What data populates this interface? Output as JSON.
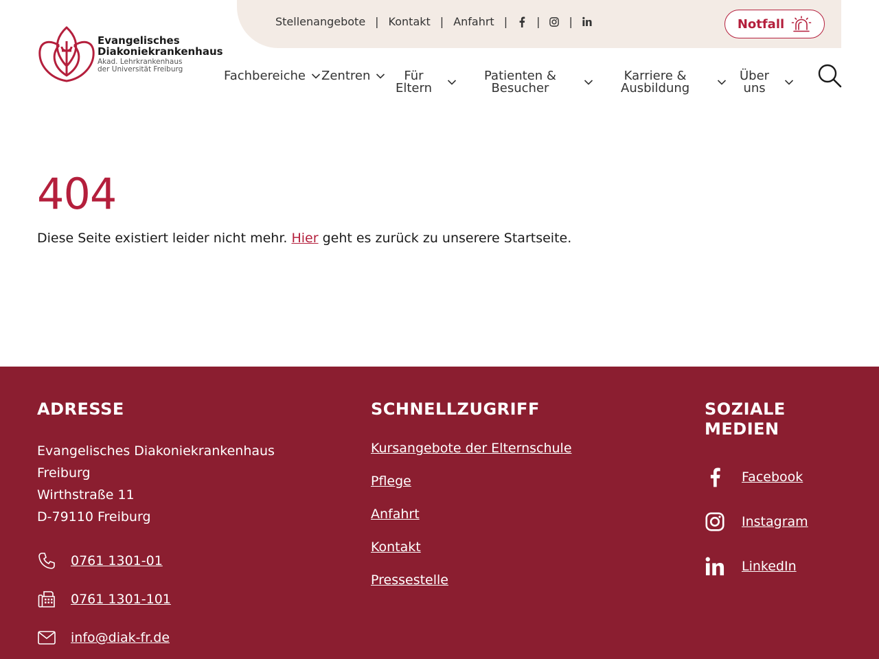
{
  "brand": {
    "name_line1": "Evangelisches",
    "name_line2": "Diakoniekrankenhaus",
    "sub_line1": "Akad. Lehrkrankenhaus",
    "sub_line2": "der Universität Freiburg",
    "accent": "#b41f3c",
    "footer_bg": "#8b1e30",
    "topbar_bg": "#f3ebe5"
  },
  "topbar": {
    "links": [
      "Stellenangebote",
      "Kontakt",
      "Anfahrt"
    ],
    "social_icons": [
      "facebook-icon",
      "instagram-icon",
      "linkedin-icon"
    ],
    "emergency_label": "Notfall"
  },
  "nav": {
    "items": [
      {
        "line1": "Fachbereiche",
        "line2": ""
      },
      {
        "line1": "Zentren",
        "line2": ""
      },
      {
        "line1": "Für",
        "line2": "Eltern"
      },
      {
        "line1": "Patienten &",
        "line2": "Besucher"
      },
      {
        "line1": "Karriere &",
        "line2": "Ausbildung"
      },
      {
        "line1": "Über",
        "line2": "uns"
      }
    ]
  },
  "main": {
    "heading": "404",
    "text_before": "Diese Seite existiert leider nicht mehr. ",
    "link": "Hier",
    "text_after": " geht es zurück zu unserere Startseite."
  },
  "footer": {
    "address": {
      "title": "ADRESSE",
      "lines": [
        "Evangelisches Diakoniekrankenhaus",
        "Freiburg",
        "Wirthstraße 11",
        "D-79110 Freiburg"
      ],
      "phone": "0761 1301-01",
      "fax": "0761 1301-101",
      "email": "info@diak-fr.de"
    },
    "quick": {
      "title": "SCHNELLZUGRIFF",
      "links": [
        "Kursangebote der Elternschule",
        "Pflege",
        "Anfahrt",
        "Kontakt",
        "Pressestelle"
      ]
    },
    "social": {
      "title_line1": "SOZIALE",
      "title_line2": "MEDIEN",
      "links": [
        "Facebook",
        "Instagram",
        "LinkedIn"
      ]
    }
  }
}
